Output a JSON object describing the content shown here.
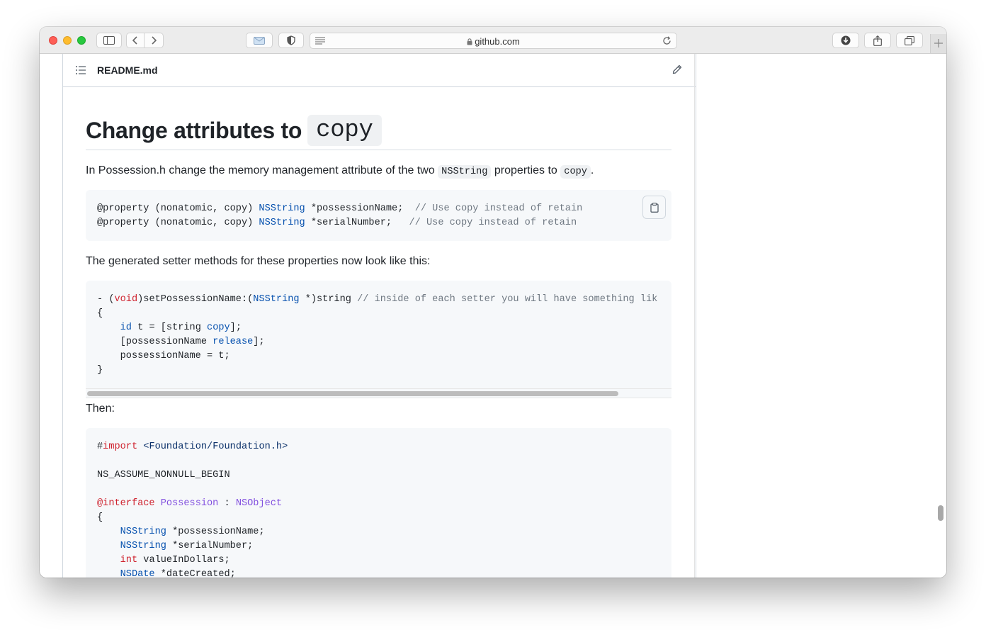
{
  "browser": {
    "url": "github.com",
    "colors": {
      "close": "#fe5f57",
      "minimize": "#febc2e",
      "zoom": "#28c840"
    },
    "icons": [
      "sidebar-icon",
      "back-icon",
      "forward-icon",
      "mail-icon",
      "shield-icon",
      "reader-icon",
      "lock-icon",
      "reload-icon",
      "download-icon",
      "share-icon",
      "tabs-icon",
      "new-tab-icon"
    ]
  },
  "readme": {
    "filename": "README.md",
    "heading_text": "Change attributes to",
    "heading_code": "copy",
    "para1": {
      "before": "In Possession.h change the memory management attribute of the two",
      "code1": "NSString",
      "middle": "properties to",
      "code2": "copy",
      "after": "."
    },
    "block1": {
      "line1": {
        "p1": "@property (nonatomic, copy) ",
        "type": "NSString",
        "p2": " *possessionName;  ",
        "comment": "// Use copy instead of retain"
      },
      "line2": {
        "p1": "@property (nonatomic, copy) ",
        "type": "NSString",
        "p2": " *serialNumber;   ",
        "comment": "// Use copy instead of retain"
      }
    },
    "para2": "The generated setter methods for these properties now look like this:",
    "block2": {
      "l1_a": "- (",
      "l1_void": "void",
      "l1_b": ")setPossessionName:(",
      "l1_type": "NSString",
      "l1_c": " *)string ",
      "l1_comment": "// inside of each setter you will have something lik",
      "l2": "{",
      "l3_a": "    ",
      "l3_id": "id",
      "l3_b": " t = [string ",
      "l3_copy": "copy",
      "l3_c": "];",
      "l4_a": "    [possessionName ",
      "l4_release": "release",
      "l4_b": "];",
      "l5": "    possessionName = t;",
      "l6": "}"
    },
    "para3": "Then:",
    "block3": {
      "l1_hash": "#",
      "l1_import": "import",
      "l1_space": " ",
      "l1_path": "<Foundation/Foundation.h>",
      "l3": "NS_ASSUME_NONNULL_BEGIN",
      "l5_interface": "@interface",
      "l5_space": " ",
      "l5_class": "Possession",
      "l5_colon": " : ",
      "l5_super": "NSObject",
      "l6": "{",
      "l7_indent": "    ",
      "l7_type": "NSString",
      "l7_rest": " *possessionName;",
      "l8_indent": "    ",
      "l8_type": "NSString",
      "l8_rest": " *serialNumber;",
      "l9_indent": "    ",
      "l9_type": "int",
      "l9_rest": " valueInDollars;",
      "l10_indent": "    ",
      "l10_type": "NSDate",
      "l10_rest": " *dateCreated;",
      "l11": "}"
    }
  }
}
